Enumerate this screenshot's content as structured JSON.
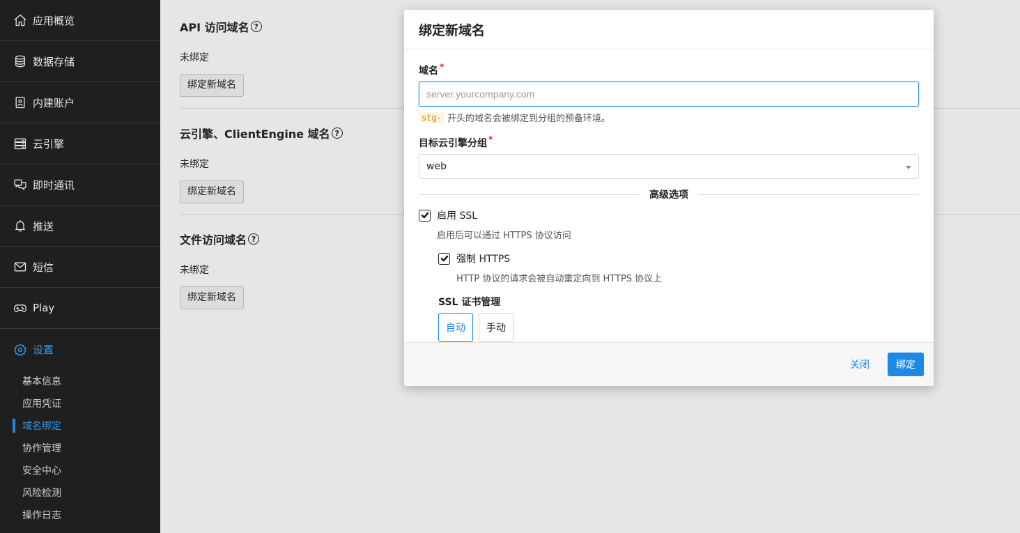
{
  "sidebar": {
    "items": [
      {
        "label": "应用概览",
        "icon": "home-icon"
      },
      {
        "label": "数据存储",
        "icon": "database-icon"
      },
      {
        "label": "内建账户",
        "icon": "user-badge-icon"
      },
      {
        "label": "云引擎",
        "icon": "server-icon"
      },
      {
        "label": "即时通讯",
        "icon": "chat-icon"
      },
      {
        "label": "推送",
        "icon": "bell-icon"
      },
      {
        "label": "短信",
        "icon": "mail-icon"
      },
      {
        "label": "Play",
        "icon": "gamepad-icon"
      },
      {
        "label": "设置",
        "icon": "gear-icon"
      }
    ],
    "sub_items": [
      {
        "label": "基本信息"
      },
      {
        "label": "应用凭证"
      },
      {
        "label": "域名绑定",
        "active": true
      },
      {
        "label": "协作管理"
      },
      {
        "label": "安全中心"
      },
      {
        "label": "风险检测"
      },
      {
        "label": "操作日志"
      }
    ]
  },
  "main": {
    "sections": [
      {
        "title": "API 访问域名",
        "status": "未绑定",
        "button": "绑定新域名"
      },
      {
        "title": "云引擎、ClientEngine 域名",
        "status": "未绑定",
        "button": "绑定新域名"
      },
      {
        "title": "文件访问域名",
        "status": "未绑定",
        "button": "绑定新域名"
      }
    ],
    "help_glyph": "?"
  },
  "modal": {
    "title": "绑定新域名",
    "domain": {
      "label": "域名",
      "required_mark": "*",
      "value": "",
      "placeholder": "server.yourcompany.com",
      "hint_code": "stg-",
      "hint_text": "开头的域名会被绑定到分组的预备环境。"
    },
    "group": {
      "label": "目标云引擎分组",
      "required_mark": "*",
      "selected": "web"
    },
    "advanced_label": "高级选项",
    "ssl": {
      "enable_label": "启用 SSL",
      "enable_checked": true,
      "enable_desc": "启用后可以通过 HTTPS 协议访问",
      "force_label": "强制 HTTPS",
      "force_checked": true,
      "force_desc": "HTTP 协议的请求会被自动重定向到 HTTPS 协议上",
      "cert_label": "SSL 证书管理",
      "cert_options": [
        "自动",
        "手动"
      ],
      "cert_selected": "自动"
    },
    "footer": {
      "close_label": "关闭",
      "submit_label": "绑定"
    }
  },
  "colors": {
    "accent": "#1e88e5",
    "sidebar_bg": "#1f1f1f",
    "required": "#e02424"
  }
}
